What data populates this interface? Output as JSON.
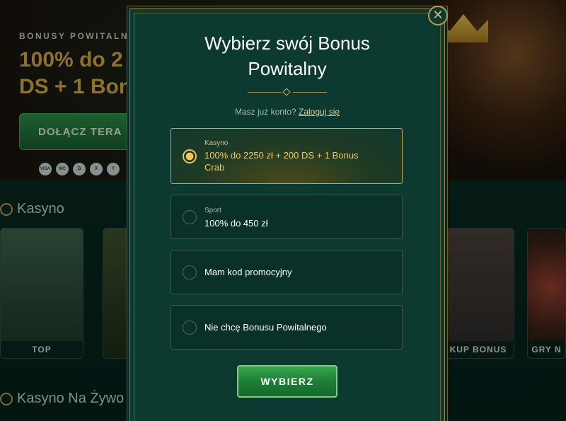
{
  "background": {
    "hero": {
      "subtitle": "BONUSY POWITALNE",
      "title": "100% do 2\nDS + 1 Bon",
      "join_label": "DOŁĄCZ TERA",
      "payments": [
        "VISA",
        "MC",
        "₿",
        "₮",
        "T"
      ]
    },
    "sections": [
      {
        "title": "Kasyno"
      },
      {
        "title": "Kasyno Na Żywo"
      }
    ],
    "tiles": [
      "TOP",
      "KUP BONUS",
      "GRY N"
    ]
  },
  "modal": {
    "title": "Wybierz swój Bonus\nPowitalny",
    "close_symbol": "✕",
    "login_prompt": "Masz już konto?",
    "login_link": "Zaloguj się",
    "options": [
      {
        "category": "Kasyno",
        "label": "100% do 2250 zł + 200 DS + 1 Bonus\nCrab",
        "selected": true
      },
      {
        "category": "Sport",
        "label": "100% do 450 zł",
        "selected": false
      },
      {
        "category": "",
        "label": "Mam kod promocyjny",
        "selected": false
      },
      {
        "category": "",
        "label": "Nie chcę Bonusu Powitalnego",
        "selected": false
      }
    ],
    "submit_label": "WYBIERZ"
  },
  "colors": {
    "modal_bg": "#0d3a30",
    "gold_accent": "#c5a655",
    "selected_text": "#f1c75a",
    "button_green": "#1f7f36"
  }
}
